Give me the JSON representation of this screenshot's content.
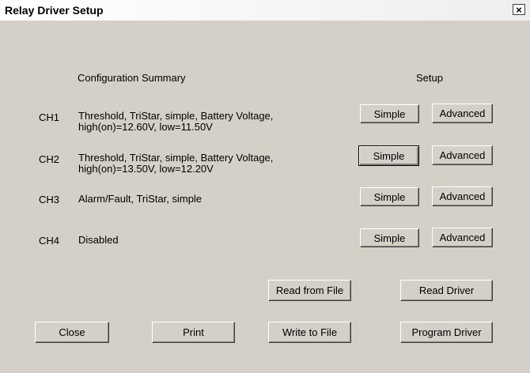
{
  "window": {
    "title": "Relay Driver Setup",
    "close_label": "×"
  },
  "headers": {
    "summary": "Configuration Summary",
    "setup": "Setup"
  },
  "channels": [
    {
      "id": "CH1",
      "summary_line1": "Threshold, TriStar, simple, Battery Voltage,",
      "summary_line2": "high(on)=12.60V, low=11.50V",
      "simple_label": "Simple",
      "advanced_label": "Advanced"
    },
    {
      "id": "CH2",
      "summary_line1": "Threshold, TriStar, simple, Battery Voltage,",
      "summary_line2": "high(on)=13.50V, low=12.20V",
      "simple_label": "Simple",
      "advanced_label": "Advanced"
    },
    {
      "id": "CH3",
      "summary_line1": "Alarm/Fault, TriStar, simple",
      "summary_line2": "",
      "simple_label": "Simple",
      "advanced_label": "Advanced"
    },
    {
      "id": "CH4",
      "summary_line1": "Disabled",
      "summary_line2": "",
      "simple_label": "Simple",
      "advanced_label": "Advanced"
    }
  ],
  "buttons": {
    "read_from_file": "Read from File",
    "read_driver": "Read Driver",
    "close": "Close",
    "print": "Print",
    "write_to_file": "Write to File",
    "program_driver": "Program Driver"
  }
}
